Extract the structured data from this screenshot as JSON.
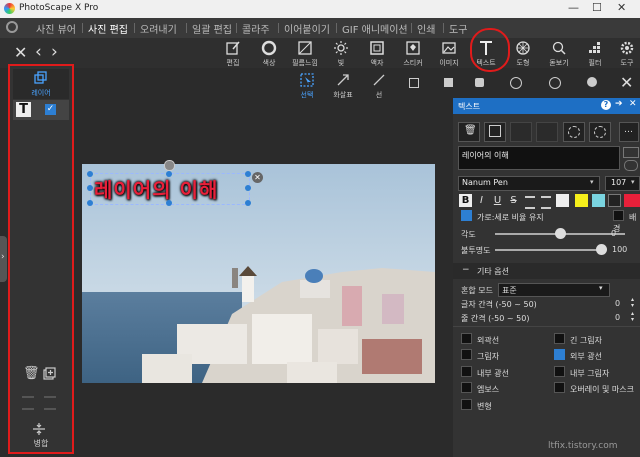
{
  "window": {
    "title": "PhotoScape X Pro"
  },
  "menu": {
    "tabs": [
      "사진 뷰어",
      "사진 편집",
      "오려내기",
      "일괄 편집",
      "콜라주",
      "이어붙이기",
      "GIF 애니메이션",
      "인쇄",
      "도구"
    ],
    "active_index": 1
  },
  "toolbar": {
    "items": [
      {
        "label": "편집",
        "icon": "edit-icon"
      },
      {
        "label": "색상",
        "icon": "color-circle-icon"
      },
      {
        "label": "필름느낌",
        "icon": "film-icon"
      },
      {
        "label": "빛",
        "icon": "sun-icon"
      },
      {
        "label": "액자",
        "icon": "frame-icon"
      },
      {
        "label": "스티커",
        "icon": "sticker-icon"
      },
      {
        "label": "이미지",
        "icon": "image-icon"
      },
      {
        "label": "텍스트",
        "icon": "text-icon"
      },
      {
        "label": "도형",
        "icon": "shape-icon"
      },
      {
        "label": "돋보기",
        "icon": "magnifier-icon"
      },
      {
        "label": "필터",
        "icon": "filter-icon"
      },
      {
        "label": "도구",
        "icon": "gear-icon"
      }
    ]
  },
  "subtools": [
    {
      "label": "선택"
    },
    {
      "label": "화살표"
    },
    {
      "label": "선"
    }
  ],
  "left_panel": {
    "layer_label": "레이어",
    "layer_type_glyph": "T",
    "merge_label": "병합"
  },
  "canvas": {
    "text_object": "레이어의 이해"
  },
  "right_panel": {
    "title": "텍스트",
    "text_value": "레이어의 이해",
    "font_name": "Nanum Pen",
    "font_size": "107",
    "bold_glyph": "B",
    "italic_glyph": "I",
    "underline_glyph": "U",
    "strike_glyph": "S",
    "keep_ratio_label": "가로:세로 비율 유지",
    "keep_ratio_checked": true,
    "bg_label": "배경",
    "angle_label": "각도",
    "angle_value": "0",
    "angle_fraction": 0.5,
    "opacity_label": "불투명도",
    "opacity_value": "100",
    "opacity_fraction": 1.0,
    "other_options_label": "기타 옵션",
    "blend_label": "혼합 모드",
    "blend_value": "표준",
    "char_spacing_label": "글자 간격 (-50 ~ 50)",
    "char_spacing_value": "0",
    "line_spacing_label": "줄 간격 (-50 ~ 50)",
    "line_spacing_value": "0",
    "checks": [
      {
        "label": "외곽선",
        "checked": false
      },
      {
        "label": "긴 그림자",
        "checked": false
      },
      {
        "label": "그림자",
        "checked": false
      },
      {
        "label": "외부 광선",
        "checked": true
      },
      {
        "label": "내부 광선",
        "checked": false
      },
      {
        "label": "내부 그림자",
        "checked": false
      },
      {
        "label": "엠보스",
        "checked": false
      },
      {
        "label": "오버레이 및 마스크",
        "checked": false
      },
      {
        "label": "변형",
        "checked": false
      }
    ]
  },
  "watermark": "ltfix.tistory.com",
  "colors": {
    "accent": "#2d7fd3",
    "highlight_red": "#e01b1b",
    "text_object_red": "#e8203a"
  }
}
